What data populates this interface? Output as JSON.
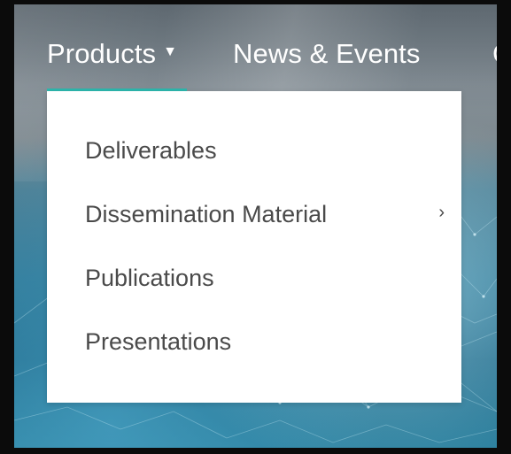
{
  "nav": {
    "items": [
      {
        "label": "Products"
      },
      {
        "label": "News & Events"
      },
      {
        "label": "C"
      }
    ],
    "caret_icon": "chevron-down-icon"
  },
  "dropdown": {
    "items": [
      {
        "label": "Deliverables"
      },
      {
        "label": "Dissemination Material",
        "submenu_icon": "chevron-right-icon"
      },
      {
        "label": "Publications"
      },
      {
        "label": "Presentations"
      }
    ]
  },
  "colors": {
    "accent": "#2db7ad",
    "dropdown_text": "#4a4a4a",
    "nav_text": "#ffffff",
    "frame": "#0b0b0b"
  }
}
